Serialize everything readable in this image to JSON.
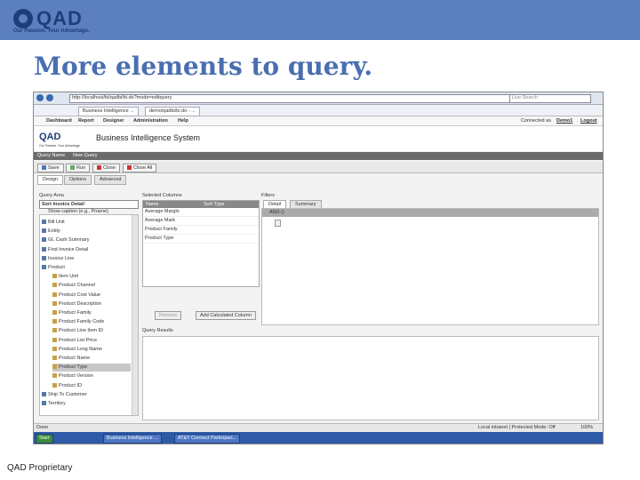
{
  "slide": {
    "logo_text": "QAD",
    "tagline": "Our Passion. Your Advantage.",
    "title": "More elements to query.",
    "footer": "QAD Proprietary"
  },
  "browser": {
    "address": "http://localhost/bi/qadbi/bi.do?mode=editquery",
    "search_placeholder": "Live Search",
    "tab1": "Business Intelligence ...",
    "tab2": "demo/qadbi/bi.do - ..."
  },
  "menu": {
    "items": [
      "Dashboard",
      "Report",
      "Designer",
      "Administration",
      "Help"
    ],
    "connected_label": "Connected as",
    "user": "Demo1",
    "logout": "Logout"
  },
  "app": {
    "logo": "QAD",
    "logo_tagline": "Our Passion. Your Advantage.",
    "title": "Business Intelligence System",
    "breadcrumb": "Query Name",
    "breadcrumb_value": "New Query",
    "toolbar": [
      "Save",
      "Run",
      "Close",
      "Close All"
    ],
    "subtabs": [
      "Design",
      "Options",
      "Advanced"
    ]
  },
  "query_area": {
    "label": "Query Area",
    "selected": "Sort Invoice Detail",
    "show_caption": "Show caption (e.g., Pname)",
    "items": [
      {
        "label": "Bill Unit",
        "indent": 0,
        "selected": false
      },
      {
        "label": "Entity",
        "indent": 0,
        "selected": false
      },
      {
        "label": "GL Cash Summary",
        "indent": 0,
        "selected": false
      },
      {
        "label": "Find Invoice Detail",
        "indent": 0,
        "selected": false
      },
      {
        "label": "Invoice Line",
        "indent": 0,
        "selected": false
      },
      {
        "label": "Product",
        "indent": 0,
        "selected": false
      },
      {
        "label": "Item Unit",
        "indent": 1,
        "selected": false
      },
      {
        "label": "Product Channel",
        "indent": 1,
        "selected": false
      },
      {
        "label": "Product Cost Value",
        "indent": 1,
        "selected": false
      },
      {
        "label": "Product Description",
        "indent": 1,
        "selected": false
      },
      {
        "label": "Product Family",
        "indent": 1,
        "selected": false
      },
      {
        "label": "Product Family Code",
        "indent": 1,
        "selected": false
      },
      {
        "label": "Product Line Item ID",
        "indent": 1,
        "selected": false
      },
      {
        "label": "Product List Price",
        "indent": 1,
        "selected": false
      },
      {
        "label": "Product Long Name",
        "indent": 1,
        "selected": false
      },
      {
        "label": "Product Name",
        "indent": 1,
        "selected": false
      },
      {
        "label": "Product Type",
        "indent": 1,
        "selected": true
      },
      {
        "label": "Product Version",
        "indent": 1,
        "selected": false
      },
      {
        "label": "Product ID",
        "indent": 1,
        "selected": false
      },
      {
        "label": "Ship To Customer",
        "indent": 0,
        "selected": false
      },
      {
        "label": "Territory",
        "indent": 0,
        "selected": false
      }
    ]
  },
  "selected_columns": {
    "label": "Selected Columns",
    "headers": [
      "Name",
      "Sort Type"
    ],
    "rows": [
      "Average Margin",
      "Average Mark",
      "Product Family",
      "Product Type"
    ],
    "remove_button": "Remove",
    "add_button": "Add Calculated Column"
  },
  "filters": {
    "label": "Filters",
    "tabs": [
      "Detail",
      "Summary"
    ],
    "and_label": "AND ()"
  },
  "query_results": {
    "label": "Query Results"
  },
  "status": {
    "left": "Done",
    "zone": "Local intranet | Protected Mode: Off",
    "zoom": "100%"
  },
  "taskbar": {
    "start": "Start",
    "tasks": [
      "Business Intelligence ...",
      "AT&T Connect Participan..."
    ]
  },
  "colors": {
    "band": "#5b7fbf",
    "title": "#4a6fb0",
    "qad_blue": "#1f3d7a"
  }
}
